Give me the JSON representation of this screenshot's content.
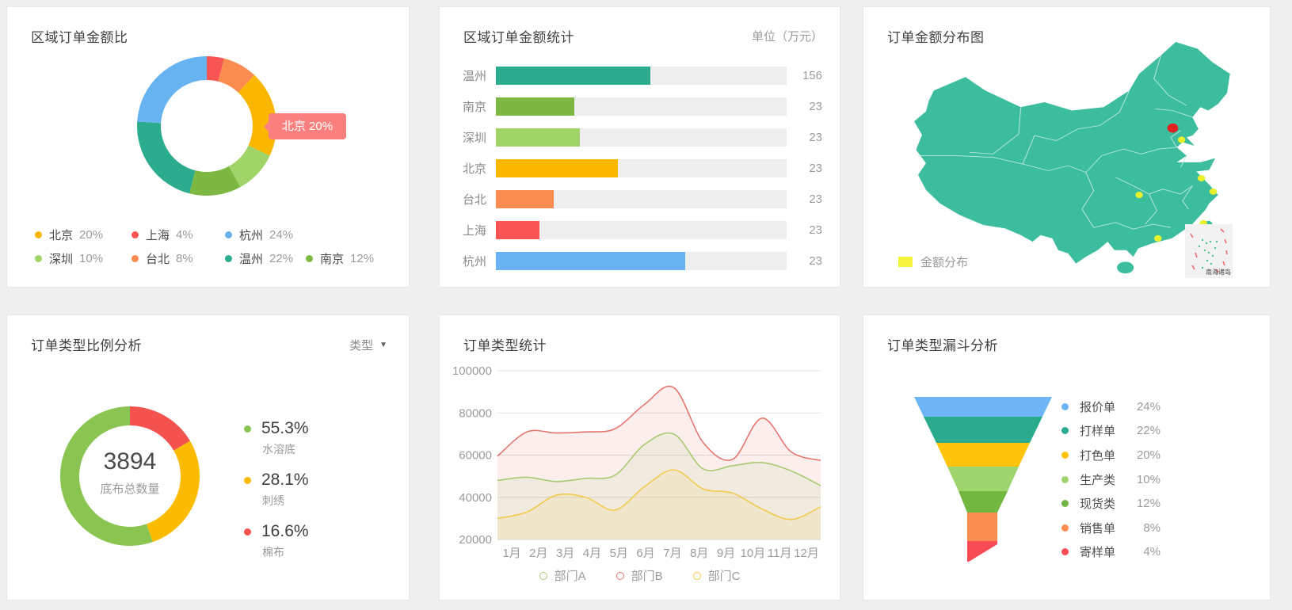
{
  "cards": {
    "region_donut": {
      "title": "区域订单金额比",
      "tooltip": "北京 20%",
      "tooltip_color": "#FA8080",
      "legend": [
        {
          "label": "北京",
          "value": "20%",
          "color": "#FBB700"
        },
        {
          "label": "上海",
          "value": "4%",
          "color": "#F95454"
        },
        {
          "label": "杭州",
          "value": "24%",
          "color": "#67B2F1"
        },
        {
          "label": "深圳",
          "value": "10%",
          "color": "#A0D468"
        },
        {
          "label": "台北",
          "value": "8%",
          "color": "#FB8C4F"
        },
        {
          "label": "温州",
          "value": "22%",
          "color": "#2BAC8E"
        },
        {
          "label": "南京",
          "value": "12%",
          "color": "#7CB842"
        }
      ]
    },
    "region_bars": {
      "title": "区域订单金额统计",
      "unit": "单位（万元）"
    },
    "map": {
      "title": "订单金额分布图",
      "legend_label": "金额分布",
      "legend_color": "#F6F33C",
      "inset_label": "南海诸岛"
    },
    "type_donut": {
      "title": "订单类型比例分析",
      "dropdown_label": "类型",
      "center_value": "3894",
      "center_label": "底布总数量",
      "stats": [
        {
          "pct": "55.3%",
          "label": "水溶底",
          "color": "#8AC552"
        },
        {
          "pct": "28.1%",
          "label": "刺绣",
          "color": "#FBBB00"
        },
        {
          "pct": "16.6%",
          "label": "棉布",
          "color": "#F4524E"
        }
      ]
    },
    "type_line": {
      "title": "订单类型统计"
    },
    "funnel": {
      "title": "订单类型漏斗分析"
    }
  },
  "chart_data": [
    {
      "panel": "区域订单金额比",
      "type": "donut",
      "start": "top",
      "direction": "clockwise",
      "active_tooltip": "北京 20%",
      "segments": [
        {
          "label": "上海",
          "value": 4,
          "color": "#F95454"
        },
        {
          "label": "台北",
          "value": 8,
          "color": "#FB8C4F"
        },
        {
          "label": "北京",
          "value": 20,
          "color": "#FBB700"
        },
        {
          "label": "深圳",
          "value": 10,
          "color": "#A0D468"
        },
        {
          "label": "南京",
          "value": 12,
          "color": "#7CB842"
        },
        {
          "label": "温州",
          "value": 22,
          "color": "#2BAC8E"
        },
        {
          "label": "杭州",
          "value": 24,
          "color": "#67B2F1"
        }
      ]
    },
    {
      "panel": "区域订单金额统计",
      "type": "bar-horizontal",
      "unit": "万元",
      "categories": [
        "温州",
        "南京",
        "深圳",
        "北京",
        "台北",
        "上海",
        "杭州"
      ],
      "values": [
        156,
        23,
        23,
        23,
        23,
        23,
        23
      ],
      "bar_fill_pct": [
        53,
        27,
        29,
        42,
        20,
        15,
        65
      ],
      "colors": [
        "#2BAC8E",
        "#7CB842",
        "#A0D468",
        "#FBB700",
        "#FB8C4F",
        "#F95454",
        "#67B2F1"
      ]
    },
    {
      "panel": "订单金额分布图",
      "type": "map",
      "region": "China",
      "map_color": "#3CBD9E",
      "legend": [
        {
          "label": "金额分布",
          "color": "#F6F33C"
        }
      ],
      "inset_label": "南海诸岛",
      "markers": [
        {
          "color": "#E02222",
          "x": 302,
          "y": 117,
          "size": "large"
        },
        {
          "color": "#E7F12B",
          "x": 311,
          "y": 131
        },
        {
          "color": "#E7F12B",
          "x": 331,
          "y": 177
        },
        {
          "color": "#E7F12B",
          "x": 343,
          "y": 193
        },
        {
          "color": "#E7F12B",
          "x": 268,
          "y": 197
        },
        {
          "color": "#E7F12B",
          "x": 287,
          "y": 249
        },
        {
          "color": "#E7F12B",
          "x": 333,
          "y": 231
        }
      ]
    },
    {
      "panel": "订单类型比例分析",
      "type": "donut",
      "total": 3894,
      "total_label": "底布总数量",
      "start": "top",
      "direction": "clockwise",
      "segments": [
        {
          "label": "棉布",
          "value": 16.6,
          "color": "#F4524E"
        },
        {
          "label": "刺绣",
          "value": 28.1,
          "color": "#FBBB00"
        },
        {
          "label": "水溶底",
          "value": 55.3,
          "color": "#8AC552"
        }
      ]
    },
    {
      "panel": "订单类型统计",
      "type": "area-line",
      "x": [
        "1月",
        "2月",
        "3月",
        "4月",
        "5月",
        "6月",
        "7月",
        "8月",
        "9月",
        "10月",
        "11月",
        "12月"
      ],
      "ylim": [
        20000,
        100000
      ],
      "yticks": [
        20000,
        40000,
        60000,
        80000,
        100000
      ],
      "legend_position": "bottom",
      "series": [
        {
          "name": "部门A",
          "color": "#A8CA70",
          "values": [
            48000,
            49500,
            47500,
            49000,
            50500,
            65000,
            70000,
            53500,
            55000,
            56500,
            52500,
            45500
          ]
        },
        {
          "name": "部门B",
          "color": "#E5766E",
          "values": [
            59500,
            71000,
            70500,
            71000,
            72500,
            84000,
            92000,
            66000,
            58000,
            77500,
            61500,
            57500
          ]
        },
        {
          "name": "部门C",
          "color": "#F2CA4C",
          "values": [
            30000,
            33000,
            41000,
            40000,
            34000,
            45000,
            53000,
            44000,
            42000,
            34500,
            29500,
            35500
          ]
        }
      ]
    },
    {
      "panel": "订单类型漏斗分析",
      "type": "funnel",
      "items": [
        {
          "label": "报价单",
          "value": 24,
          "display": "24%",
          "color": "#6FB5F5"
        },
        {
          "label": "打样单",
          "value": 22,
          "display": "22%",
          "color": "#2BAB8E"
        },
        {
          "label": "打色单",
          "value": 20,
          "display": "20%",
          "color": "#FFC30B"
        },
        {
          "label": "生产类",
          "value": 10,
          "display": "10%",
          "color": "#9FD56F"
        },
        {
          "label": "现货类",
          "value": 12,
          "display": "12%",
          "color": "#72B840"
        },
        {
          "label": "销售单",
          "value": 8,
          "display": "8%",
          "color": "#FB8E51"
        },
        {
          "label": "寄样单",
          "value": 4,
          "display": "4%",
          "color": "#F94B55"
        }
      ]
    }
  ]
}
